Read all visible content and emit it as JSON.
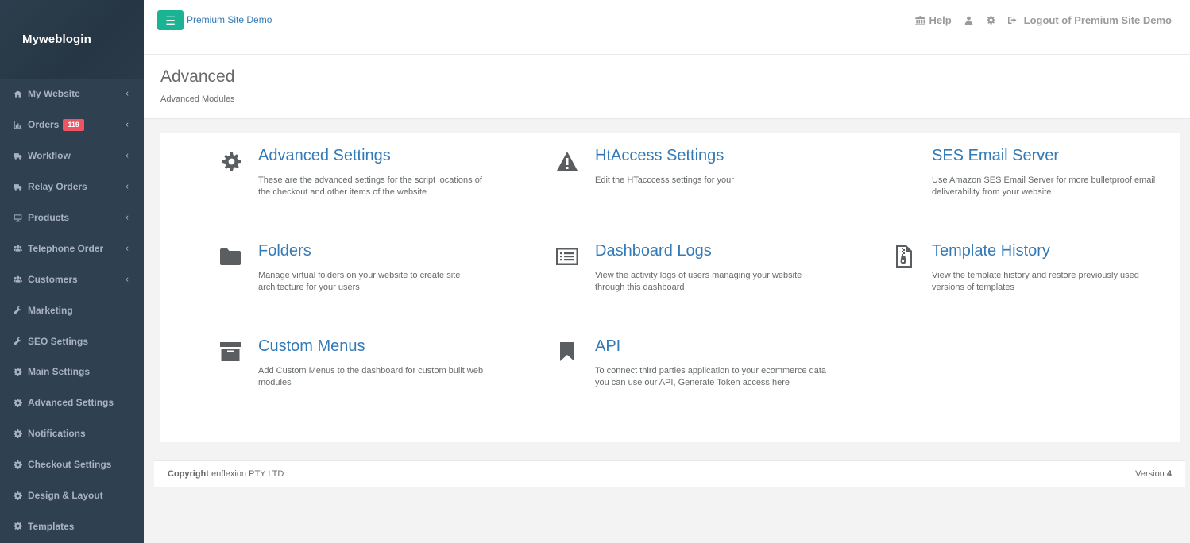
{
  "brand": "Myweblogin",
  "sidebar": {
    "items": [
      {
        "label": "My Website",
        "icon": "home-icon",
        "chevron": "‹"
      },
      {
        "label": "Orders",
        "icon": "bar-chart-icon",
        "chevron": "‹",
        "badge": "119"
      },
      {
        "label": "Workflow",
        "icon": "truck-icon",
        "chevron": "‹"
      },
      {
        "label": "Relay Orders",
        "icon": "truck-icon",
        "chevron": "‹"
      },
      {
        "label": "Products",
        "icon": "desktop-icon",
        "chevron": "‹"
      },
      {
        "label": "Telephone Order",
        "icon": "users-icon",
        "chevron": "‹"
      },
      {
        "label": "Customers",
        "icon": "users-icon",
        "chevron": "‹"
      },
      {
        "label": "Marketing",
        "icon": "wrench-icon"
      },
      {
        "label": "SEO Settings",
        "icon": "wrench-icon"
      },
      {
        "label": "Main Settings",
        "icon": "gear-icon"
      },
      {
        "label": "Advanced Settings",
        "icon": "gear-icon"
      },
      {
        "label": "Notifications",
        "icon": "gear-icon"
      },
      {
        "label": "Checkout Settings",
        "icon": "gear-icon"
      },
      {
        "label": "Design & Layout",
        "icon": "gear-icon"
      },
      {
        "label": "Templates",
        "icon": "gear-icon"
      }
    ]
  },
  "topbar": {
    "site_link": "Premium Site Demo",
    "help": "Help",
    "logout": "Logout of Premium Site Demo"
  },
  "heading": {
    "title": "Advanced",
    "subtitle": "Advanced Modules"
  },
  "modules": [
    {
      "title": "Advanced Settings",
      "desc": "These are the advanced settings for the script locations of the checkout and other items of the website",
      "icon": "gear-icon"
    },
    {
      "title": "HtAccess Settings",
      "desc": "Edit the HTacccess settings for your",
      "icon": "warning-icon"
    },
    {
      "title": "SES Email Server",
      "desc": "Use Amazon SES Email Server for more bulletproof email deliverability from your website",
      "icon": ""
    },
    {
      "title": "Folders",
      "desc": "Manage virtual folders on your website to create site architecture for your users",
      "icon": "folder-icon"
    },
    {
      "title": "Dashboard Logs",
      "desc": "View the activity logs of users managing your website through this dashboard",
      "icon": "list-icon"
    },
    {
      "title": "Template History",
      "desc": "View the template history and restore previously used versions of templates",
      "icon": "file-zip-icon"
    },
    {
      "title": "Custom Menus",
      "desc": "Add Custom Menus to the dashboard for custom built web modules",
      "icon": "archive-icon"
    },
    {
      "title": "API",
      "desc": "To connect third parties application to your ecommerce data you can use our API, Generate Token access here",
      "icon": "bookmark-icon"
    }
  ],
  "footer": {
    "copyright_label": "Copyright",
    "company": "enflexion PTY LTD",
    "version_label": "Version",
    "version": "4"
  },
  "colors": {
    "sidebar_bg": "#2f4050",
    "accent": "#1ab394",
    "link": "#337ab7",
    "badge": "#ed5565"
  }
}
